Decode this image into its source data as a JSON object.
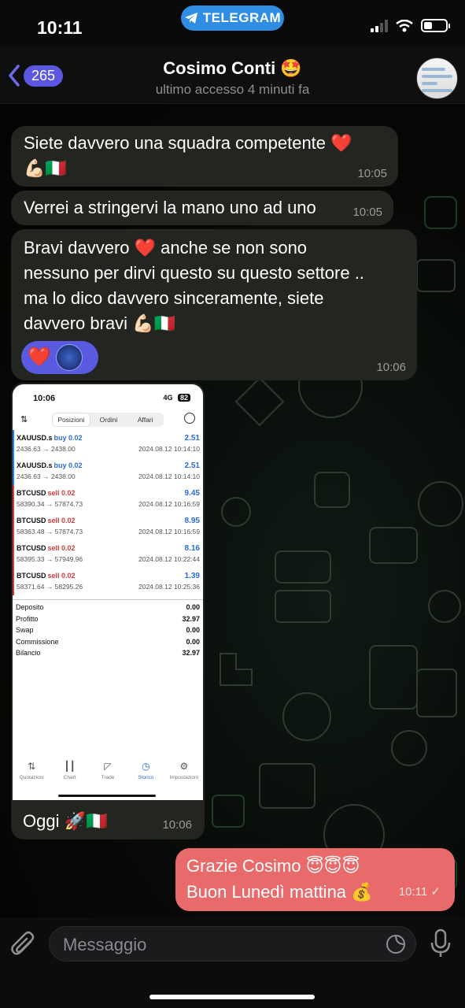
{
  "status_bar": {
    "time": "10:11",
    "app_pill": "TELEGRAM",
    "battery_level": 0.35
  },
  "header": {
    "back_count": "265",
    "title": "Cosimo Conti 🤩",
    "subtitle": "ultimo accesso 4 minuti fa"
  },
  "messages": [
    {
      "text_line1": "Siete davvero una squadra competente ❤️",
      "text_line2": "💪🏻🇮🇹",
      "time": "10:05"
    },
    {
      "text": "Verrei a stringervi la mano uno ad uno",
      "time": "10:05"
    },
    {
      "lines": [
        "Bravi davvero ❤️ anche se non sono",
        "nessuno per dirvi questo su questo settore ..",
        "ma lo dico davvero sinceramente, siete",
        "davvero bravi 💪🏻🇮🇹"
      ],
      "time": "10:06",
      "reaction": "❤️"
    }
  ],
  "photo": {
    "caption": "Oggi 🚀🇮🇹",
    "time": "10:06",
    "screenshot": {
      "time": "10:06",
      "signal": "4G",
      "battery": "82",
      "tabs": [
        "Posizioni",
        "Ordini",
        "Affari"
      ],
      "active_tab": "Posizioni",
      "trades": [
        {
          "symbol": "XAUUSD.s",
          "direction": "buy 0.02",
          "pnl": "2.51",
          "prices": "2436.63 → 2438.00",
          "date": "2024.08.12 10:14:10"
        },
        {
          "symbol": "XAUUSD.s",
          "direction": "buy 0.02",
          "pnl": "2.51",
          "prices": "2436.63 → 2438.00",
          "date": "2024.08.12 10:14:10"
        },
        {
          "symbol": "BTCUSD",
          "direction": "sell 0.02",
          "pnl": "9.45",
          "prices": "58390.34 → 57874.73",
          "date": "2024.08.12 10:16:59"
        },
        {
          "symbol": "BTCUSD",
          "direction": "sell 0.02",
          "pnl": "8.95",
          "prices": "58363.48 → 57874.73",
          "date": "2024.08.12 10:16:59"
        },
        {
          "symbol": "BTCUSD",
          "direction": "sell 0.02",
          "pnl": "8.16",
          "prices": "58395.33 → 57949.96",
          "date": "2024.08.12 10:22:44"
        },
        {
          "symbol": "BTCUSD",
          "direction": "sell 0.02",
          "pnl": "1.39",
          "prices": "58371.64 → 58295.26",
          "date": "2024.08.12 10:25:36"
        }
      ],
      "summary": [
        {
          "label": "Deposito",
          "value": "0.00"
        },
        {
          "label": "Profitto",
          "value": "32.97"
        },
        {
          "label": "Swap",
          "value": "0.00"
        },
        {
          "label": "Commissione",
          "value": "0.00"
        },
        {
          "label": "Bilancio",
          "value": "32.97"
        }
      ],
      "nav": [
        "Quotazioni",
        "Chart",
        "Trade",
        "Storico",
        "Impostazioni"
      ],
      "active_nav": "Storico"
    }
  },
  "outgoing": {
    "line1": "Grazie Cosimo 😇😇😇",
    "line2": "Buon Lunedì mattina 💰",
    "time": "10:11"
  },
  "composer": {
    "placeholder": "Messaggio"
  },
  "colors": {
    "incoming_bubble": "#232521",
    "outgoing_bubble": "#e86a6a",
    "accent": "#5c57e0",
    "telegram": "#2f8de4"
  }
}
